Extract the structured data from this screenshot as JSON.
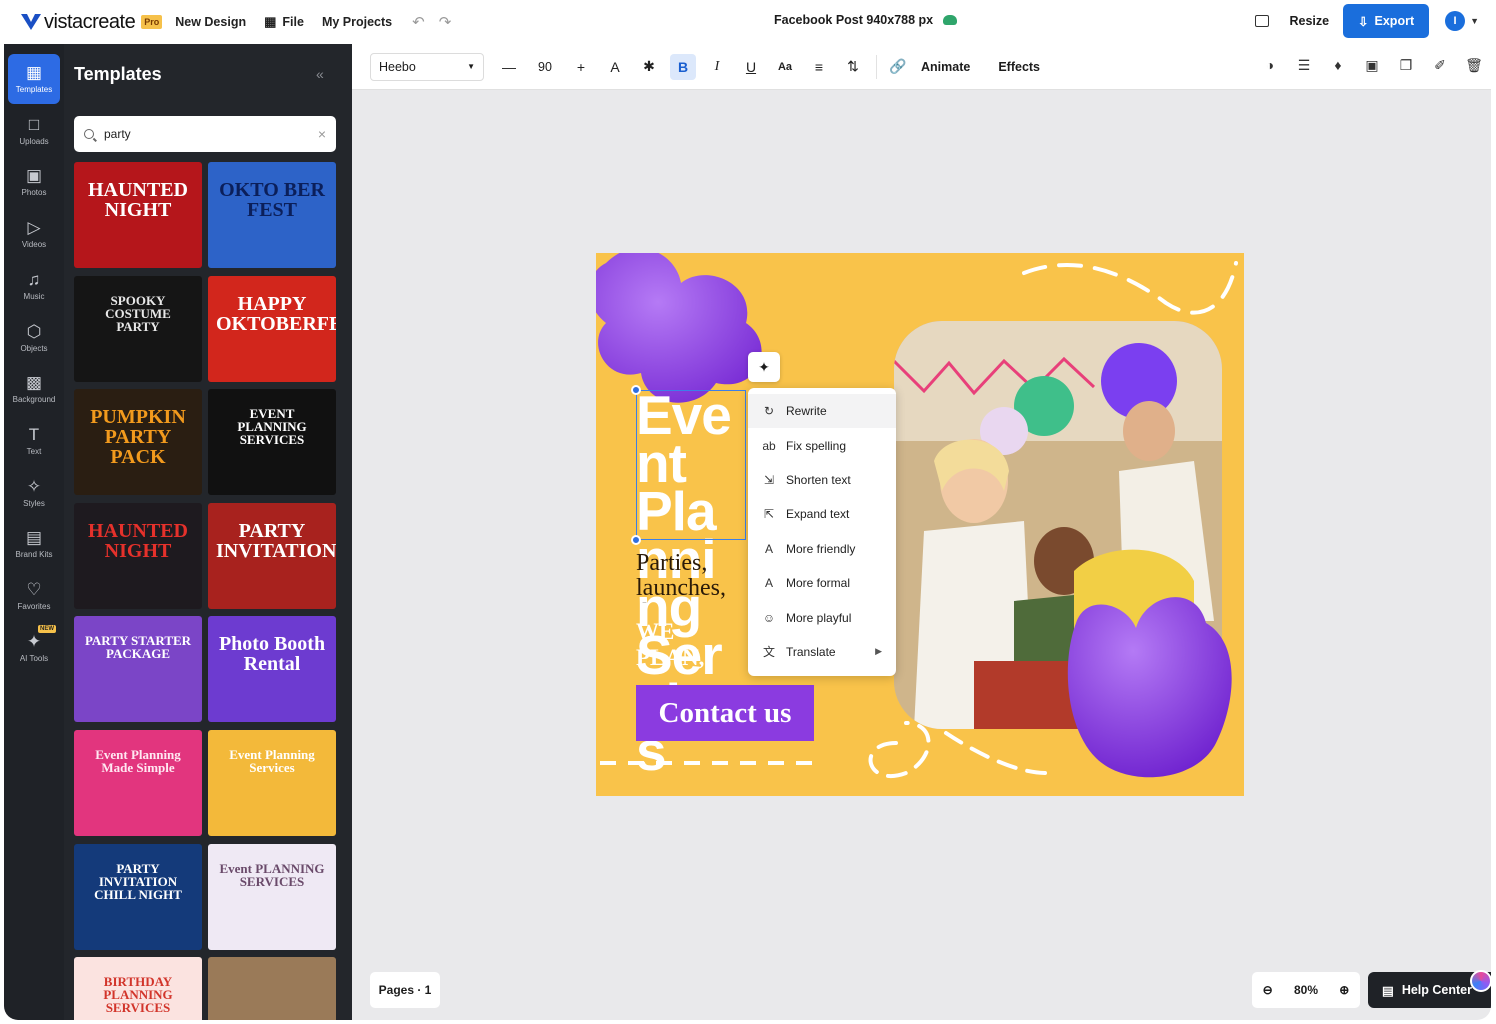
{
  "topbar": {
    "brand": "vistacreate",
    "pro_badge": "Pro",
    "new_design": "New Design",
    "file": "File",
    "my_projects": "My Projects",
    "doc_title": "Facebook Post 940x788 px",
    "resize": "Resize",
    "export": "Export",
    "avatar_initial": "I"
  },
  "rail": {
    "items": [
      {
        "label": "Templates",
        "icon": "templates-icon"
      },
      {
        "label": "Uploads",
        "icon": "folder-icon"
      },
      {
        "label": "Photos",
        "icon": "image-icon"
      },
      {
        "label": "Videos",
        "icon": "play-icon"
      },
      {
        "label": "Music",
        "icon": "music-icon"
      },
      {
        "label": "Objects",
        "icon": "shapes-icon"
      },
      {
        "label": "Background",
        "icon": "hatch-icon"
      },
      {
        "label": "Text",
        "icon": "text-icon"
      },
      {
        "label": "Styles",
        "icon": "sparkle-icon"
      },
      {
        "label": "Brand Kits",
        "icon": "briefcase-icon"
      },
      {
        "label": "Favorites",
        "icon": "heart-icon"
      },
      {
        "label": "AI Tools",
        "icon": "ai-sparkle-icon"
      }
    ],
    "new_tag": "NEW"
  },
  "panel": {
    "title": "Templates",
    "search_value": "party",
    "templates": [
      {
        "title": "HAUNTED NIGHT",
        "bg": "#b5161b",
        "fg": "#ffffff"
      },
      {
        "title": "OKTO BER FEST",
        "bg": "#2d63c8",
        "fg": "#0b1f5a"
      },
      {
        "title": "SPOOKY COSTUME PARTY",
        "bg": "#151515",
        "fg": "#e8e8e8"
      },
      {
        "title": "HAPPY OKTOBERFEST",
        "bg": "#d2261c",
        "fg": "#ffffff"
      },
      {
        "title": "PUMPKIN PARTY PACK",
        "bg": "#2a1e12",
        "fg": "#f29a1d"
      },
      {
        "title": "EVENT PLANNING SERVICES",
        "bg": "#111111",
        "fg": "#ffffff"
      },
      {
        "title": "HAUNTED NIGHT",
        "bg": "#1e1a1f",
        "fg": "#e5312b"
      },
      {
        "title": "PARTY INVITATION",
        "bg": "#a8221e",
        "fg": "#ffffff"
      },
      {
        "title": "PARTY STARTER PACKAGE",
        "bg": "#7b45c7",
        "fg": "#ffffff"
      },
      {
        "title": "Photo Booth Rental",
        "bg": "#6d3bd0",
        "fg": "#ffffff"
      },
      {
        "title": "Event Planning Made Simple",
        "bg": "#e2357e",
        "fg": "#ffe8f2"
      },
      {
        "title": "Event Planning Services",
        "bg": "#f3b93a",
        "fg": "#ffffff"
      },
      {
        "title": "PARTY INVITATION CHILL NIGHT",
        "bg": "#143a7a",
        "fg": "#ffffff"
      },
      {
        "title": "Event PLANNING SERVICES",
        "bg": "#efe9f4",
        "fg": "#6a4a6a"
      },
      {
        "title": "BIRTHDAY PLANNING SERVICES",
        "bg": "#fbe3e0",
        "fg": "#d2352b"
      },
      {
        "title": "",
        "bg": "#9a7a58",
        "fg": "#ffffff"
      }
    ]
  },
  "toolbar": {
    "font": "Heebo",
    "font_size": "90",
    "animate": "Animate",
    "effects": "Effects"
  },
  "design": {
    "headline": "Event Planning Services",
    "subcopy": "Parties, launches, dinners, more",
    "tagline": "WE PLAN, YOU ENJOY",
    "cta": "Contact us",
    "bg_color": "#f9c34a",
    "accent_color": "#8b3be0"
  },
  "ai_menu": {
    "items": [
      {
        "label": "Rewrite",
        "icon": "refresh-icon"
      },
      {
        "label": "Fix spelling",
        "icon": "spellcheck-icon"
      },
      {
        "label": "Shorten text",
        "icon": "shorten-icon"
      },
      {
        "label": "Expand text",
        "icon": "expand-icon"
      },
      {
        "label": "More friendly",
        "icon": "letter-a-icon"
      },
      {
        "label": "More formal",
        "icon": "letter-a-icon"
      },
      {
        "label": "More playful",
        "icon": "smile-icon"
      },
      {
        "label": "Translate",
        "icon": "translate-icon"
      }
    ]
  },
  "bottom": {
    "pages": "Pages · 1",
    "zoom": "80%",
    "help": "Help Center"
  }
}
